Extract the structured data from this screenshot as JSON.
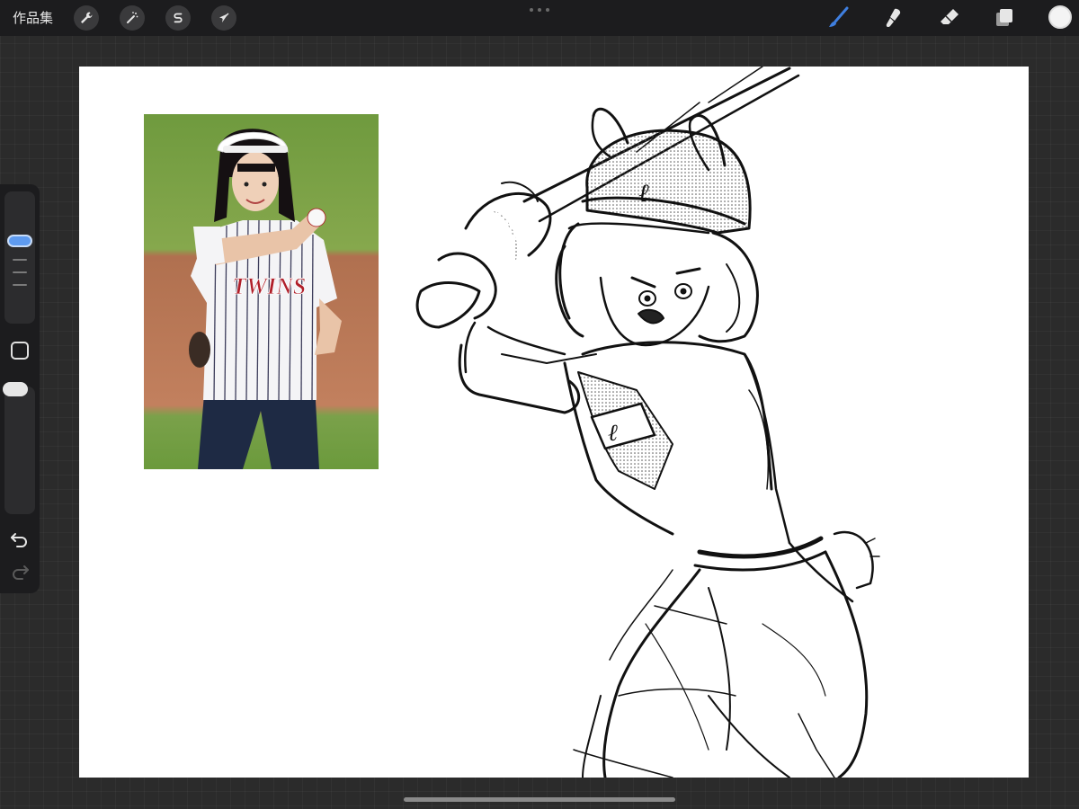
{
  "app": {
    "gallery_label": "作品集"
  },
  "toolbar": {
    "left_tools": [
      {
        "name": "actions",
        "icon": "wrench-icon"
      },
      {
        "name": "adjustments",
        "icon": "magic-wand-icon"
      },
      {
        "name": "selection",
        "icon": "selection-s-icon"
      },
      {
        "name": "transform",
        "icon": "arrow-cursor-icon"
      }
    ],
    "right_tools": [
      {
        "name": "brush",
        "icon": "brush-icon",
        "active": true
      },
      {
        "name": "smudge",
        "icon": "smudge-icon"
      },
      {
        "name": "eraser",
        "icon": "eraser-icon"
      },
      {
        "name": "layers",
        "icon": "layers-icon"
      }
    ],
    "current_color": "#f4f4f4"
  },
  "sidebar": {
    "brush_size_slider": "size-slider",
    "brush_opacity_slider": "opacity-slider",
    "modify_button_icon": "square-icon",
    "undo_icon": "undo-icon",
    "redo_icon": "redo-icon"
  },
  "colors": {
    "accent": "#5e9bf0",
    "toolbar_bg": "#1c1c1e",
    "workspace_bg": "#2b2b2b",
    "canvas_bg": "#ffffff"
  },
  "canvas": {
    "reference_jersey_text": "TWINS",
    "sketch_cap_emblem": "ℓ",
    "sketch_patch_emblem": "ℓ"
  }
}
